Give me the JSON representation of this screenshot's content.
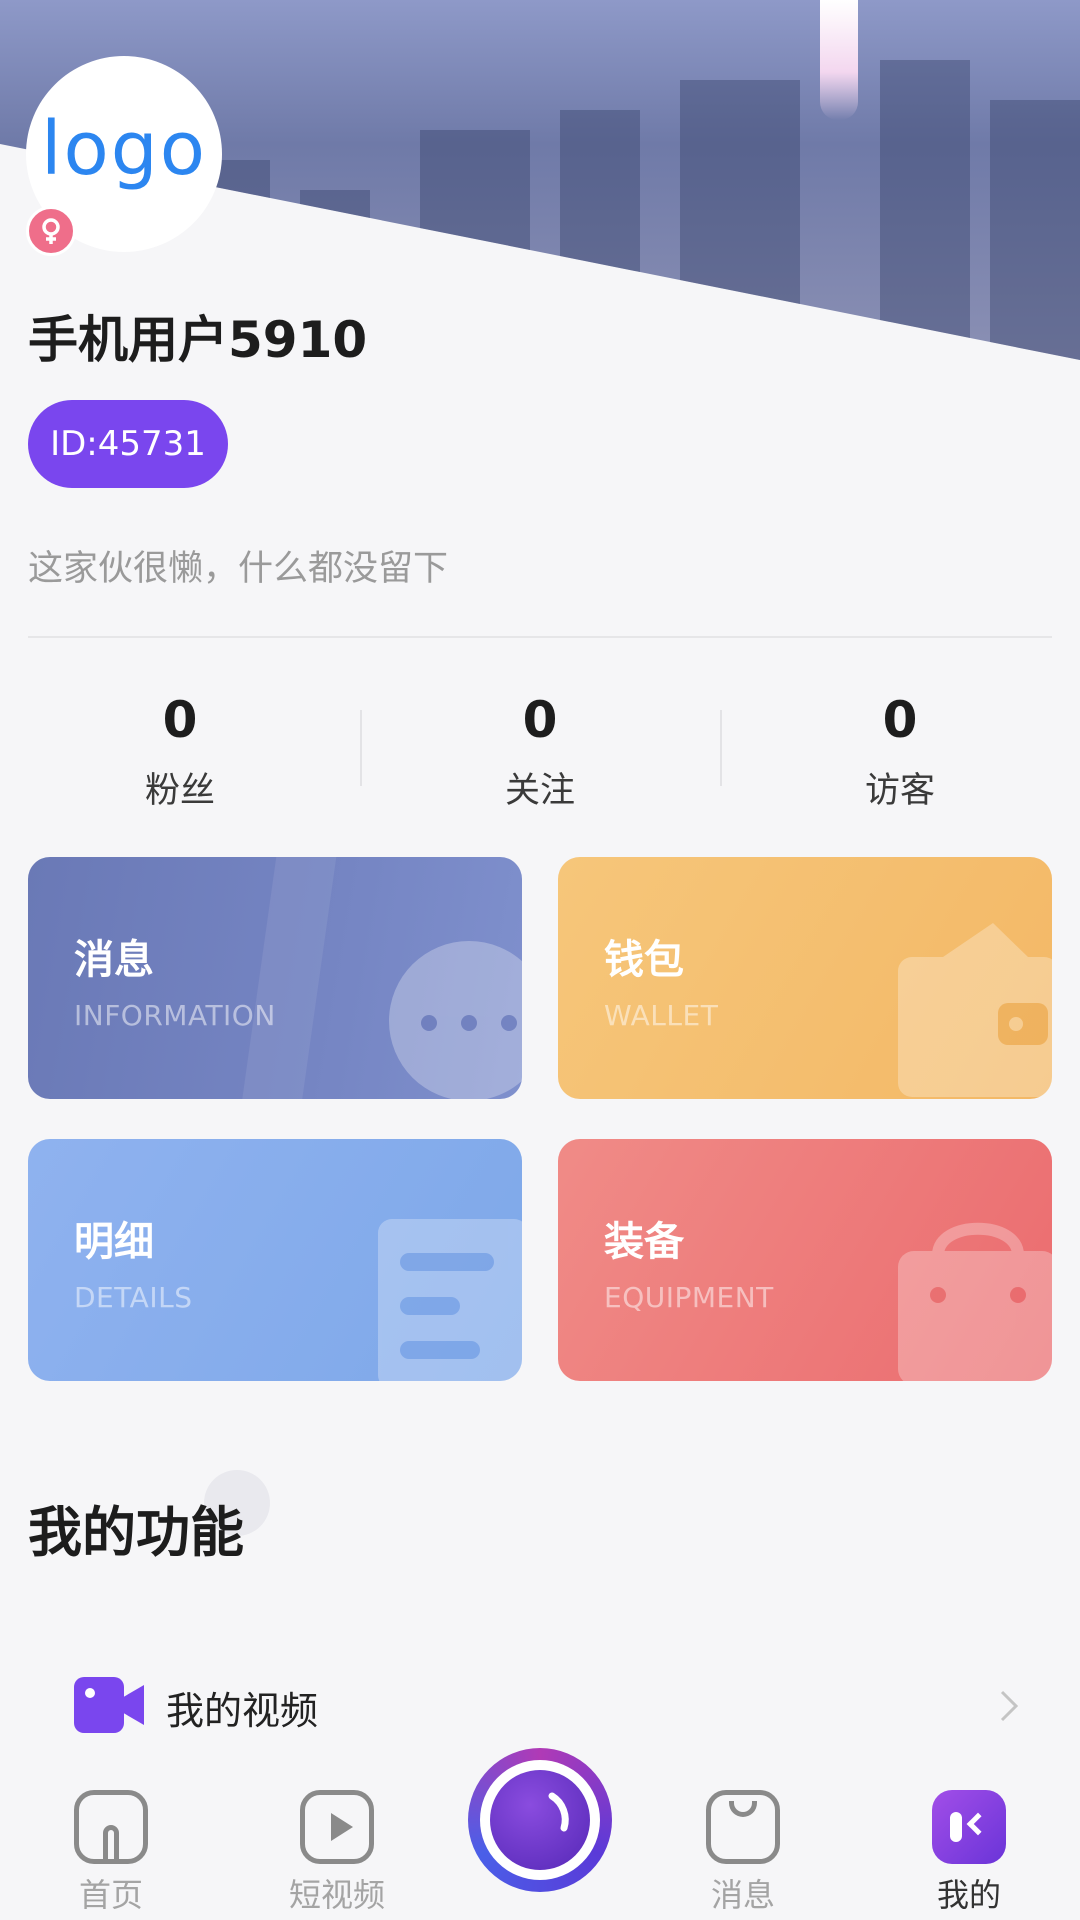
{
  "profile": {
    "avatar_text": "logo",
    "username": "手机用户5910",
    "id_label": "ID:45731",
    "bio": "这家伙很懒，什么都没留下"
  },
  "stats": [
    {
      "value": "0",
      "label": "粉丝"
    },
    {
      "value": "0",
      "label": "关注"
    },
    {
      "value": "0",
      "label": "访客"
    }
  ],
  "cards": [
    {
      "title": "消息",
      "subtitle": "INFORMATION",
      "icon": "chat-bubble-icon",
      "color": "#7080bd"
    },
    {
      "title": "钱包",
      "subtitle": "WALLET",
      "icon": "wallet-icon",
      "color": "#f4bd6f"
    },
    {
      "title": "明细",
      "subtitle": "DETAILS",
      "icon": "list-document-icon",
      "color": "#86acec"
    },
    {
      "title": "装备",
      "subtitle": "EQUIPMENT",
      "icon": "bag-icon",
      "color": "#ee7a7b"
    }
  ],
  "section": {
    "title": "我的功能",
    "items": [
      {
        "label": "我的视频",
        "icon": "video-camera-icon"
      }
    ]
  },
  "tabbar": {
    "items": [
      {
        "label": "首页",
        "icon": "home-icon"
      },
      {
        "label": "短视频",
        "icon": "play-icon"
      },
      {
        "label": "",
        "icon": "camera-lens-icon"
      },
      {
        "label": "消息",
        "icon": "shopping-bag-icon"
      },
      {
        "label": "我的",
        "icon": "profile-icon"
      }
    ],
    "active": "我的"
  },
  "colors": {
    "accent": "#7a46ee",
    "gender_badge": "#ef6e8a",
    "avatar_text": "#2c86f0",
    "background": "#f6f6f8"
  }
}
